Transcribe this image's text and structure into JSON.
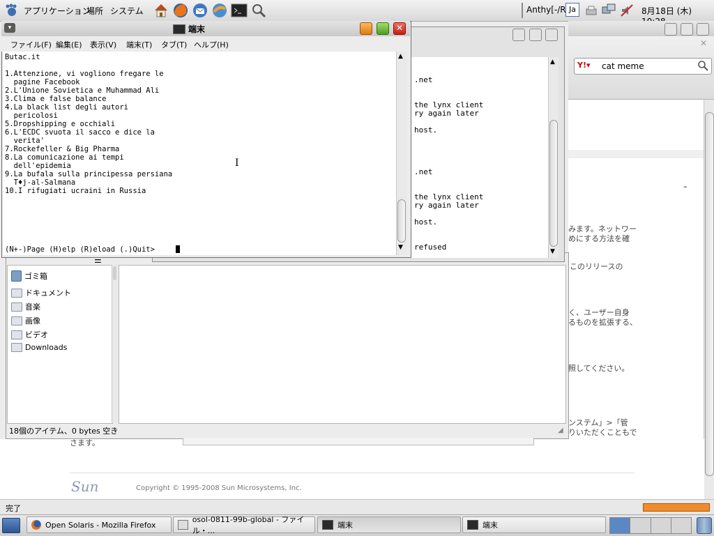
{
  "top_panel": {
    "menus": [
      "アプリケーション",
      "場所",
      "システム"
    ],
    "input_method": "Anthy[-/R]",
    "lang_badge": "Ja",
    "clock": "8月18日 (木) 10:28"
  },
  "firefox": {
    "search_value": "cat meme",
    "content_lines": [
      "みます。ネットワー",
      "めにする方法を確",
      "このリリースの",
      "く、ユーザー自身",
      "るものを拡張する、",
      "照してください。",
      "ンステム」>「管",
      "りいただくこともで"
    ],
    "left_text": "さます。",
    "copyright": "Copyright © 1995-2008 Sun Microsystems, Inc.",
    "logo": "Sun",
    "status": "完了"
  },
  "file_manager": {
    "places": [
      "ゴミ箱",
      "ドキュメント",
      "音楽",
      "画像",
      "ビデオ",
      "Downloads"
    ],
    "status": "18個のアイテム、0 bytes 空き"
  },
  "terminal2": {
    "lines": [
      ".net",
      "the lynx client",
      "ry again later",
      "host.",
      ".net",
      "the lynx client",
      "ry again later",
      "host.",
      "refused"
    ]
  },
  "terminal1": {
    "title": "端末",
    "menus": [
      "ファイル(F)",
      "編集(E)",
      "表示(V)",
      "端末(T)",
      "タブ(T)",
      "ヘルプ(H)"
    ],
    "lines": [
      "Butac.it",
      "",
      "1.Attenzione, vi vogliono fregare le",
      "  pagine Facebook",
      "2.L'Unione Sovietica e Muhammad Ali",
      "3.Clima e false balance",
      "4.La black list degli autori",
      "  pericolosi",
      "5.Dropshipping e occhiali",
      "6.L'ECDC svuota il sacco e dice la",
      "  verita'",
      "7.Rockefeller & Big Pharma",
      "8.La comunicazione ai tempi",
      "  dell'epidemia",
      "9.La bufala sulla principessa persiana",
      "  T♦j-al-Salmana",
      "10.I rifugiati ucraini in Russia"
    ],
    "prompt": "(N+-)Page (H)elp (R)eload (.)Quit>"
  },
  "taskbar": {
    "tasks": [
      "Open Solaris - Mozilla Firefox",
      "osol-0811-99b-global - ファイル・...",
      "端末",
      "端末"
    ]
  },
  "colors": {
    "accent": "#f0932b",
    "close": "#d7261b"
  }
}
